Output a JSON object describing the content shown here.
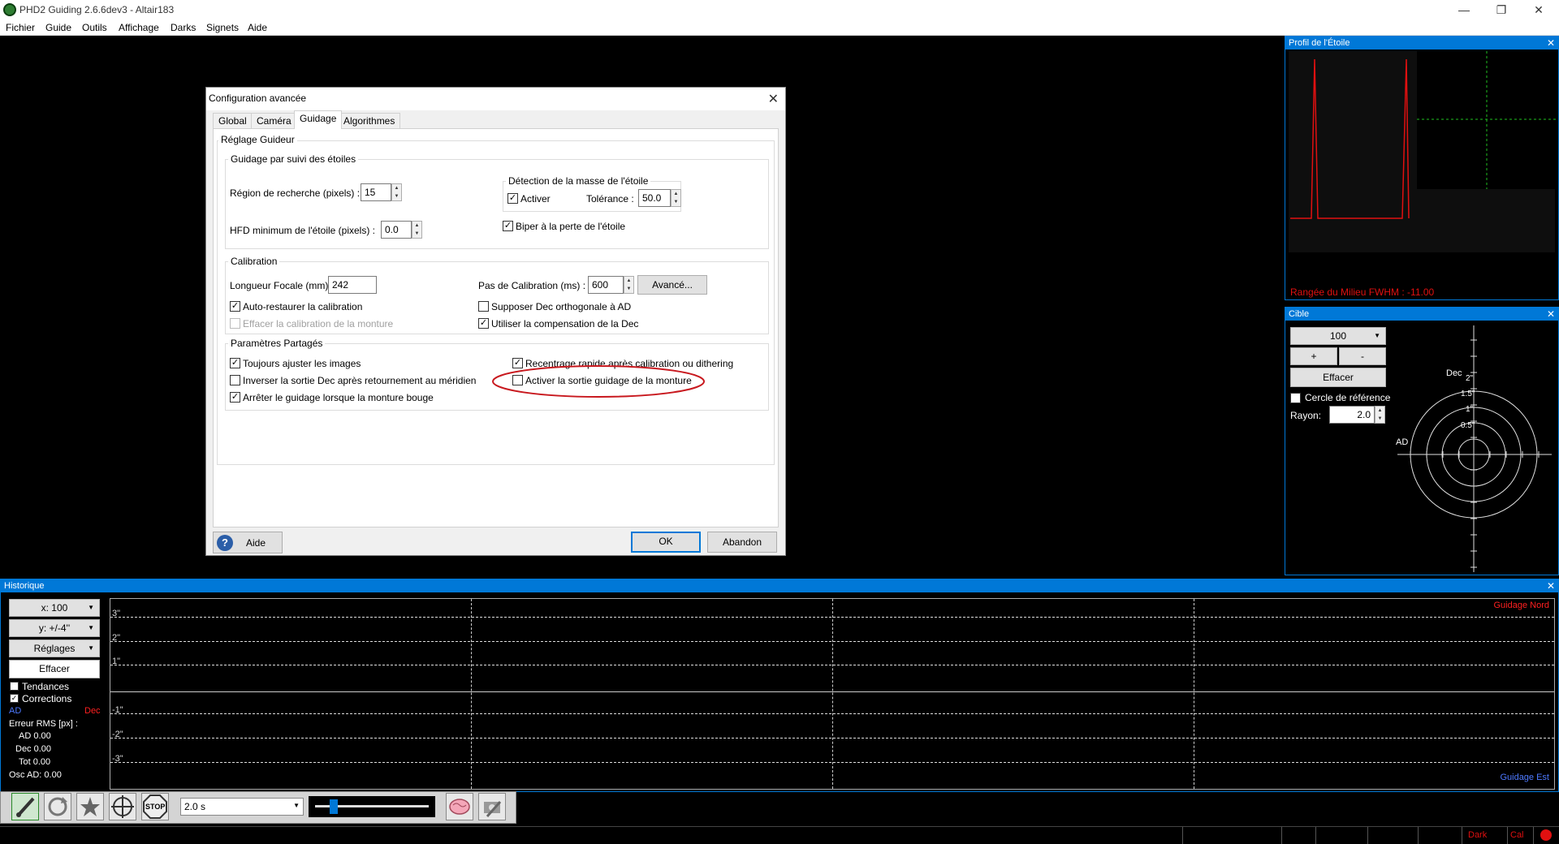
{
  "window": {
    "title": "PHD2 Guiding 2.6.6dev3 - Altair183",
    "minimize": "—",
    "maximize": "❐",
    "close": "✕"
  },
  "menu": [
    "Fichier",
    "Guide",
    "Outils",
    "Affichage",
    "Darks",
    "Signets",
    "Aide"
  ],
  "profile_panel": {
    "title": "Profil de l'Étoile",
    "close": "✕",
    "readout": "Rangée du Milieu FWHM : -11.00"
  },
  "target_panel": {
    "title": "Cible",
    "close": "✕",
    "zoom_value": "100",
    "plus": "+",
    "minus": "-",
    "clear": "Effacer",
    "ref_circle_label": "Cercle de référence",
    "radius_label": "Rayon:",
    "radius_value": "2.0",
    "dec_label": "Dec",
    "ad_label": "AD",
    "ring_labels": [
      "2\"",
      "1.5\"",
      "1\"",
      "0.5\""
    ]
  },
  "dialog": {
    "title": "Configuration avancée",
    "close": "✕",
    "tabs": [
      "Global",
      "Caméra",
      "Guidage",
      "Algorithmes"
    ],
    "active_tab": "Guidage",
    "section_title": "Réglage Guideur",
    "star_tracking": {
      "title": "Guidage par suivi des étoiles",
      "search_region_label": "Région de recherche (pixels) :",
      "search_region_value": "15",
      "min_hfd_label": "HFD minimum de l'étoile (pixels) :",
      "min_hfd_value": "0.0",
      "mass_detect": {
        "title": "Détection de la masse de l'étoile",
        "enable_label": "Activer",
        "enable_checked": "✓",
        "tolerance_label": "Tolérance :",
        "tolerance_value": "50.0"
      },
      "beep_label": "Biper à la perte de l'étoile",
      "beep_checked": "✓"
    },
    "calibration": {
      "title": "Calibration",
      "focal_label": "Longueur Focale (mm) :",
      "focal_value": "242",
      "step_label": "Pas de Calibration (ms) :",
      "step_value": "600",
      "advanced_button": "Avancé...",
      "auto_restore_label": "Auto-restaurer la calibration",
      "auto_restore_checked": "✓",
      "assume_ortho_label": "Supposer Dec orthogonale à AD",
      "clear_mount_label": "Effacer la calibration de la monture",
      "use_dec_comp_label": "Utiliser la compensation de la Dec",
      "use_dec_comp_checked": "✓"
    },
    "shared": {
      "title": "Paramètres Partagés",
      "always_adjust_label": "Toujours ajuster les images",
      "always_adjust_checked": "✓",
      "fast_recenter_label": "Recentrage rapide après calibration ou dithering",
      "fast_recenter_checked": "✓",
      "reverse_dec_label": "Inverser la sortie Dec après retournement au méridien",
      "enable_mount_output_label": "Activer la sortie guidage de la monture",
      "stop_guiding_label": "Arrêter le guidage lorsque la monture bouge",
      "stop_guiding_checked": "✓"
    },
    "help_icon": "?",
    "help_button": "Aide",
    "ok_button": "OK",
    "cancel_button": "Abandon"
  },
  "history": {
    "title": "Historique",
    "close": "✕",
    "x_select": "x: 100",
    "y_select": "y: +/-4''",
    "settings_select": "Réglages",
    "clear_button": "Effacer",
    "trends_label": "Tendances",
    "corrections_label": "Corrections",
    "corrections_checked": "✓",
    "ad_legend": "AD",
    "dec_legend": "Dec",
    "rms_title": "Erreur RMS [px] :",
    "rms_ad": "AD 0.00",
    "rms_dec": "Dec 0.00",
    "rms_tot": "Tot 0.00",
    "osc": "Osc AD: 0.00",
    "y_ticks": [
      "3\"",
      "2\"",
      "1\"",
      "-1\"",
      "-2\"",
      "-3\""
    ],
    "north_label": "Guidage Nord",
    "east_label": "Guidage Est",
    "colors": {
      "ad": "#4d79ff",
      "dec": "#ff2020"
    }
  },
  "toolbar": {
    "exposure": "2.0 s",
    "stop_text": "STOP"
  },
  "status": {
    "dark": "Dark",
    "cal": "Cal"
  }
}
